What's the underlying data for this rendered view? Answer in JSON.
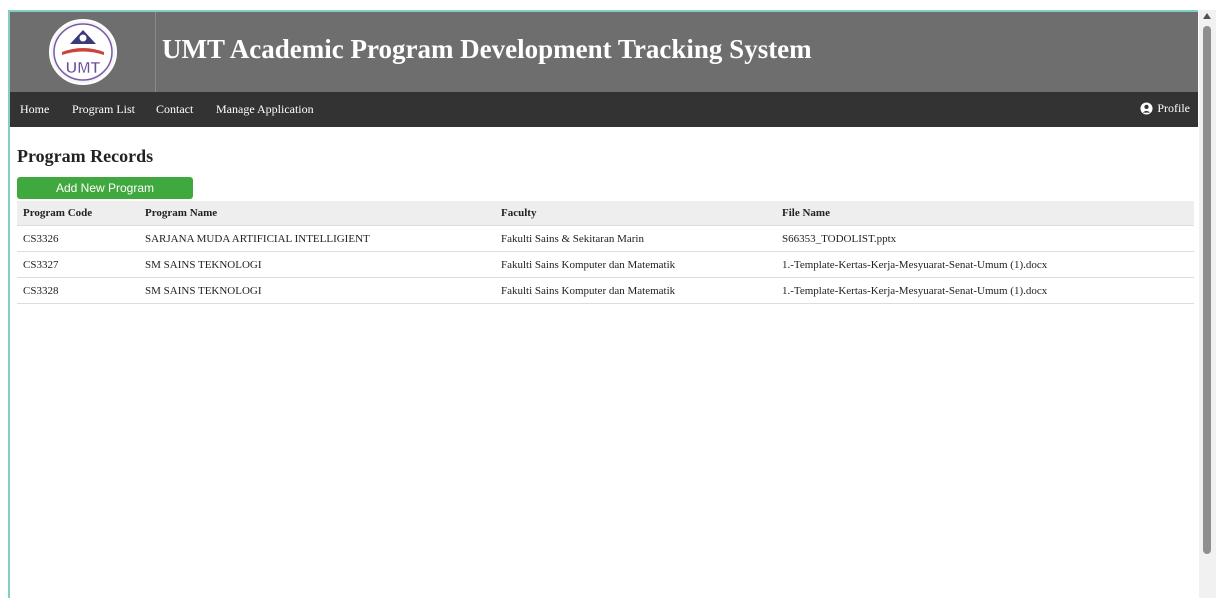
{
  "header": {
    "logo_text": "UMT",
    "title": "UMT Academic Program Development Tracking System"
  },
  "nav": {
    "items": [
      "Home",
      "Program List",
      "Contact",
      "Manage Application"
    ],
    "profile_label": "Profile"
  },
  "main": {
    "page_title": "Program Records",
    "add_button_label": "Add New Program",
    "table": {
      "columns": [
        "Program Code",
        "Program Name",
        "Faculty",
        "File Name"
      ],
      "rows": [
        [
          "CS3326",
          "SARJANA MUDA ARTIFICIAL INTELLIGIENT",
          "Fakulti Sains & Sekitaran Marin",
          "S66353_TODOLIST.pptx"
        ],
        [
          "CS3327",
          "SM SAINS TEKNOLOGI",
          "Fakulti Sains Komputer dan Matematik",
          "1.-Template-Kertas-Kerja-Mesyuarat-Senat-Umum (1).docx"
        ],
        [
          "CS3328",
          "SM SAINS TEKNOLOGI",
          "Fakulti Sains Komputer dan Matematik",
          "1.-Template-Kertas-Kerja-Mesyuarat-Senat-Umum (1).docx"
        ]
      ]
    }
  },
  "colors": {
    "header_bg": "#6e6e6e",
    "nav_bg": "#333333",
    "button_green": "#3fa93f",
    "table_header_bg": "#eeeeee"
  }
}
